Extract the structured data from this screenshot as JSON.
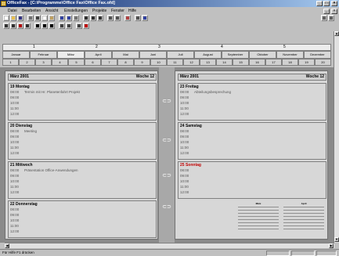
{
  "window": {
    "title": "OfficeFax - [C:\\Programme\\Office Fax\\Office Fax.ofd]"
  },
  "menu": [
    "Datei",
    "Bearbeiten",
    "Ansicht",
    "Einstellungen",
    "Projekte",
    "Fenster",
    "Hilfe"
  ],
  "ruler": {
    "numbers": [
      "1",
      "2",
      "3",
      "4",
      "5"
    ]
  },
  "months": [
    "Januar",
    "Februar",
    "März",
    "April",
    "Mai",
    "Juni",
    "Juli",
    "August",
    "September",
    "Oktober",
    "November",
    "Dezember"
  ],
  "weeks": [
    "1",
    "2",
    "3",
    "4",
    "5",
    "6",
    "7",
    "8",
    "9",
    "10",
    "11",
    "12",
    "13",
    "14",
    "15",
    "16",
    "17",
    "18",
    "19",
    "20"
  ],
  "left_page": {
    "month": "März 2001",
    "week": "Woche 12",
    "days": [
      {
        "name": "19 Montag",
        "slots": [
          "08:00",
          "09:00",
          "10:00",
          "11:00",
          "12:00"
        ],
        "appt": "Termin mit Hr. Planetenfahrt Projekt"
      },
      {
        "name": "20 Dienstag",
        "slots": [
          "08:00",
          "09:00",
          "10:00",
          "11:00",
          "12:00"
        ],
        "appt": "Meeting"
      },
      {
        "name": "21 Mittwoch",
        "slots": [
          "08:00",
          "09:00",
          "10:00",
          "11:00",
          "12:00"
        ],
        "appt": "Präsentation Office-Anwendungen"
      },
      {
        "name": "22 Donnerstag",
        "slots": [
          "08:00",
          "09:00",
          "10:00",
          "11:00",
          "12:00"
        ],
        "appt": ""
      }
    ]
  },
  "right_page": {
    "month": "März 2001",
    "week": "Woche 12",
    "days": [
      {
        "name": "23 Freitag",
        "slots": [
          "08:00",
          "09:00",
          "10:00",
          "11:00",
          "12:00"
        ],
        "appt": "Abteilungsbesprechung",
        "red": false
      },
      {
        "name": "24 Samstag",
        "slots": [
          "08:00",
          "09:00",
          "10:00",
          "11:00",
          "12:00"
        ],
        "appt": "",
        "red": false
      },
      {
        "name": "25 Sonntag",
        "slots": [
          "08:00",
          "09:00",
          "10:00",
          "11:00",
          "12:00"
        ],
        "appt": "",
        "red": true
      }
    ],
    "mini_cal_1": "März",
    "mini_cal_2": "April"
  },
  "status": {
    "text": "Für Hilfe F1 drücken"
  }
}
